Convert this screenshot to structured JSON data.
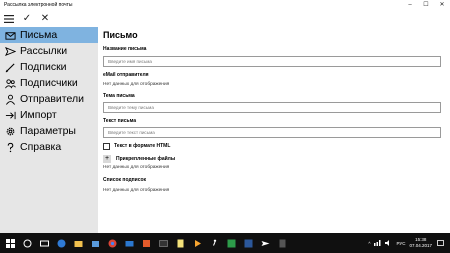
{
  "window": {
    "title": "Рассылка электронной почты",
    "controls": [
      "–",
      "☐",
      "✕"
    ]
  },
  "toolbar": {
    "save_glyph": "✓",
    "cancel_glyph": "✕"
  },
  "sidebar": {
    "items": [
      {
        "label": "Письма",
        "icon": "envelope-icon",
        "active": true
      },
      {
        "label": "Рассылки",
        "icon": "send-icon",
        "active": false
      },
      {
        "label": "Подписки",
        "icon": "pen-icon",
        "active": false
      },
      {
        "label": "Подписчики",
        "icon": "people-icon",
        "active": false
      },
      {
        "label": "Отправители",
        "icon": "person-icon",
        "active": false
      },
      {
        "label": "Импорт",
        "icon": "import-arrow-icon",
        "active": false
      },
      {
        "label": "Параметры",
        "icon": "gear-icon",
        "active": false
      },
      {
        "label": "Справка",
        "icon": "help-icon",
        "active": false
      }
    ]
  },
  "main": {
    "title": "Письмо",
    "letter_name": {
      "label": "Название письма",
      "placeholder": "Введите имя письма"
    },
    "sender": {
      "label": "eMail отправителя",
      "value": "Нет данных для отображения"
    },
    "subject": {
      "label": "Тема письма",
      "placeholder": "Введите тему письма"
    },
    "body_text": {
      "label": "Текст письма",
      "placeholder": "Введите текст письма"
    },
    "html_checkbox": {
      "label": "Текст в формате HTML",
      "checked": false
    },
    "attachments": {
      "plus": "+",
      "label": "Прикрепленные файлы",
      "value": "Нет данных для отображения"
    },
    "subscriptions": {
      "label": "Список подписок",
      "value": "Нет данных для отображения"
    }
  },
  "taskbar": {
    "start_glyph": "⊞",
    "search_glyph": "○",
    "lang": "РУС",
    "time": "15:38",
    "date": "07.04.2017"
  }
}
